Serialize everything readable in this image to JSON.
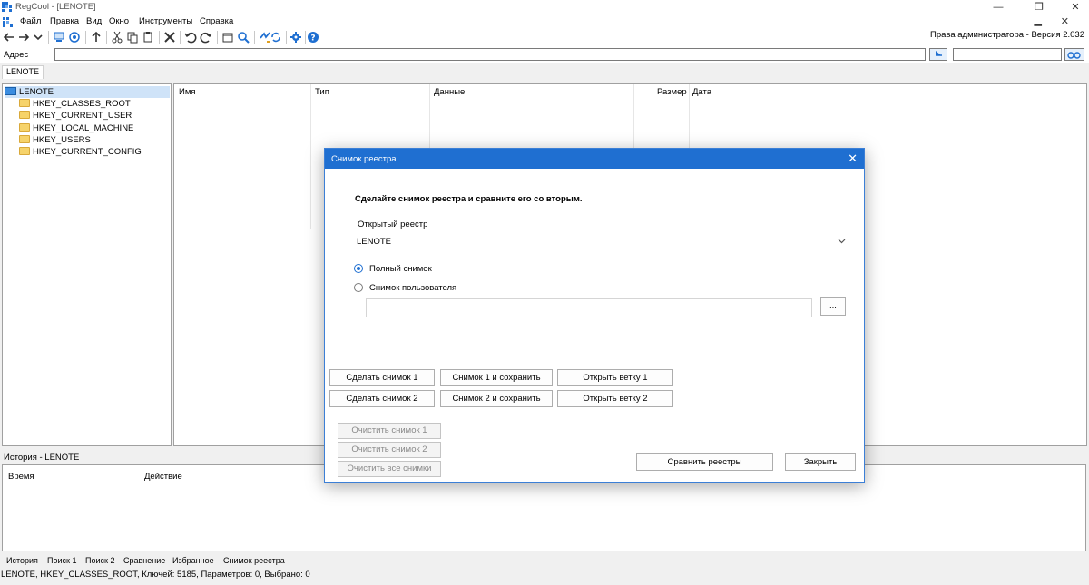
{
  "window": {
    "title": "RegCool - [LENOTE]"
  },
  "menu": {
    "items": [
      "Файл",
      "Правка",
      "Вид",
      "Окно",
      "Инструменты",
      "Справка"
    ]
  },
  "toolbar": {
    "rights_text": "Права администратора - Версия 2.032"
  },
  "address": {
    "label": "Адрес",
    "value": "",
    "search_value": ""
  },
  "tab": {
    "label": "LENOTE"
  },
  "tree": {
    "root": "LENOTE",
    "items": [
      "HKEY_CLASSES_ROOT",
      "HKEY_CURRENT_USER",
      "HKEY_LOCAL_MACHINE",
      "HKEY_USERS",
      "HKEY_CURRENT_CONFIG"
    ]
  },
  "list": {
    "columns": [
      "Имя",
      "Тип",
      "Данные",
      "Размер",
      "Дата"
    ]
  },
  "history": {
    "title": "История - LENOTE",
    "columns": [
      "Время",
      "Действие"
    ]
  },
  "bottom_tabs": [
    "История",
    "Поиск 1",
    "Поиск 2",
    "Сравнение",
    "Избранное",
    "Снимок реестра"
  ],
  "status": "LENOTE, HKEY_CLASSES_ROOT, Ключей: 5185, Параметров: 0, Выбрано: 0",
  "dialog": {
    "title": "Снимок реестра",
    "heading": "Сделайте снимок реестра и сравните его со вторым.",
    "registry_label": "Открытый реестр",
    "registry_value": "LENOTE",
    "radio_full": "Полный снимок",
    "radio_user": "Снимок пользователя",
    "path_value": "",
    "browse_label": "...",
    "btn_snap1": "Сделать снимок 1",
    "btn_snap1_save": "Снимок 1 и сохранить",
    "btn_open1": "Открыть ветку 1",
    "btn_snap2": "Сделать снимок 2",
    "btn_snap2_save": "Снимок 2 и сохранить",
    "btn_open2": "Открыть ветку 2",
    "btn_clear1": "Очистить снимок 1",
    "btn_clear2": "Очистить снимок 2",
    "btn_clear_all": "Очистить все снимки",
    "btn_compare": "Сравнить реестры",
    "btn_close": "Закрыть"
  }
}
